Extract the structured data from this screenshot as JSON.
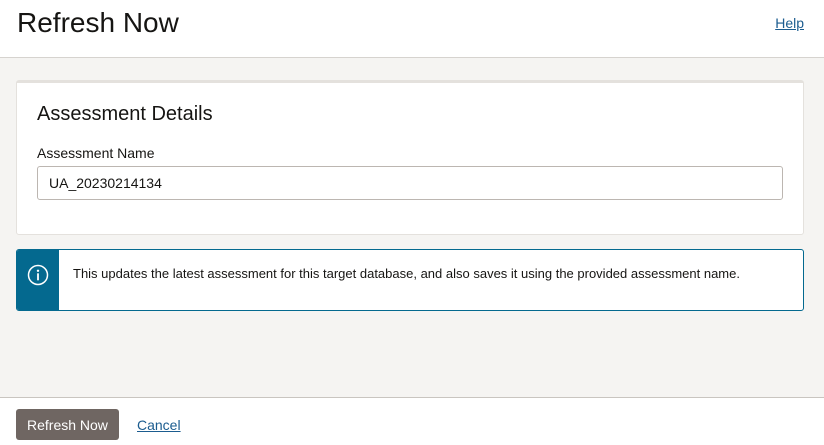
{
  "header": {
    "title": "Refresh Now",
    "help_label": "Help"
  },
  "details_card": {
    "title": "Assessment Details",
    "name_label": "Assessment Name",
    "name_value": "UA_20230214134"
  },
  "info_banner": {
    "icon": "info-icon",
    "message": "This updates the latest assessment for this target database, and also saves it using the provided assessment name."
  },
  "footer": {
    "primary_label": "Refresh Now",
    "cancel_label": "Cancel"
  },
  "colors": {
    "info_accent": "#04698f",
    "primary_button": "#6f6662",
    "link": "#1b5c8f"
  }
}
